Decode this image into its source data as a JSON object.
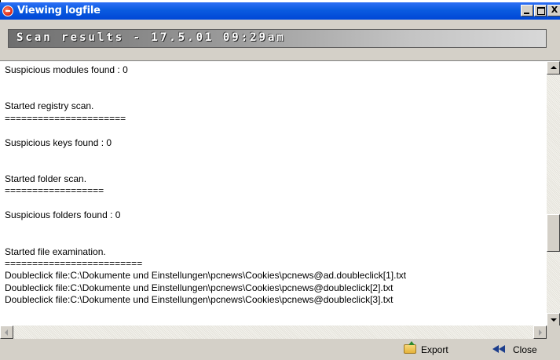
{
  "window": {
    "title": "Viewing logfile",
    "close_glyph": "X"
  },
  "header": {
    "scan_results": "Scan results - 17.5.01 09:29am"
  },
  "log": {
    "lines": [
      "Suspicious modules found : 0",
      "",
      "",
      "Started registry scan.",
      "======================",
      "",
      "Suspicious keys found : 0",
      "",
      "",
      "Started folder scan.",
      "==================",
      "",
      "Suspicious folders found : 0",
      "",
      "",
      "Started file examination.",
      "=========================",
      "Doubleclick file:C:\\Dokumente und Einstellungen\\pcnews\\Cookies\\pcnews@ad.doubleclick[1].txt",
      "Doubleclick file:C:\\Dokumente und Einstellungen\\pcnews\\Cookies\\pcnews@doubleclick[2].txt",
      "Doubleclick file:C:\\Dokumente und Einstellungen\\pcnews\\Cookies\\pcnews@doubleclick[3].txt"
    ]
  },
  "footer": {
    "export_label": "Export",
    "close_label": "Close"
  },
  "icons": {
    "app": "logfile-app-icon",
    "export": "export-folder-icon",
    "close": "double-left-arrow-icon"
  },
  "colors": {
    "titlebar": "#0a5be0",
    "window_face": "#d4d0c8",
    "log_background": "#ffffff"
  }
}
